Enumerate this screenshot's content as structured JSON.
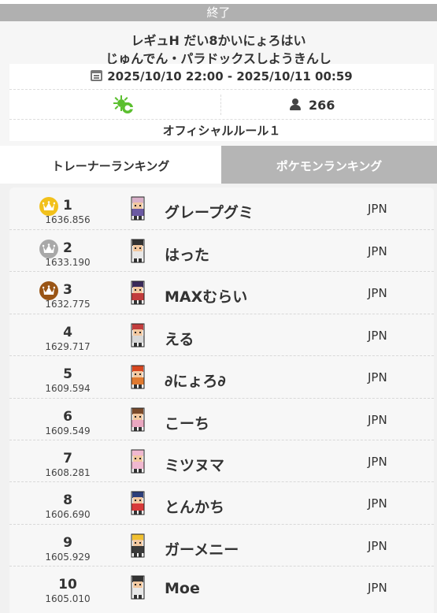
{
  "status": {
    "label": "終了"
  },
  "event": {
    "title_line1": "レギュH だい8かいにょろはい",
    "title_line2": "じゅんでん・パラドックスしようきんし",
    "date_range": "2025/10/10 22:00 - 2025/10/11 00:59",
    "format_icon": "format-gear-icon",
    "player_count": "266",
    "rule": "オフィシャルルール１"
  },
  "tabs": {
    "trainer": "トレーナーランキング",
    "pokemon": "ポケモンランキング"
  },
  "colors": {
    "crown_gold": "#f2c11b",
    "crown_silver": "#a8a8a8",
    "crown_bronze": "#9a5516",
    "format_icon": "#5bbf2f"
  },
  "ranking": [
    {
      "rank": "1",
      "rating": "1636.856",
      "name": "グレープグミ",
      "country": "JPN",
      "crown": "gold"
    },
    {
      "rank": "2",
      "rating": "1633.190",
      "name": "はった",
      "country": "JPN",
      "crown": "silver"
    },
    {
      "rank": "3",
      "rating": "1632.775",
      "name": "MAXむらい",
      "country": "JPN",
      "crown": "bronze"
    },
    {
      "rank": "4",
      "rating": "1629.717",
      "name": "える",
      "country": "JPN"
    },
    {
      "rank": "5",
      "rating": "1609.594",
      "name": "∂にょろ∂",
      "country": "JPN"
    },
    {
      "rank": "6",
      "rating": "1609.549",
      "name": "こーち",
      "country": "JPN"
    },
    {
      "rank": "7",
      "rating": "1608.281",
      "name": "ミツヌマ",
      "country": "JPN"
    },
    {
      "rank": "8",
      "rating": "1606.690",
      "name": "とんかち",
      "country": "JPN"
    },
    {
      "rank": "9",
      "rating": "1605.929",
      "name": "ガーメニー",
      "country": "JPN"
    },
    {
      "rank": "10",
      "rating": "1605.010",
      "name": "Moe",
      "country": "JPN"
    }
  ]
}
